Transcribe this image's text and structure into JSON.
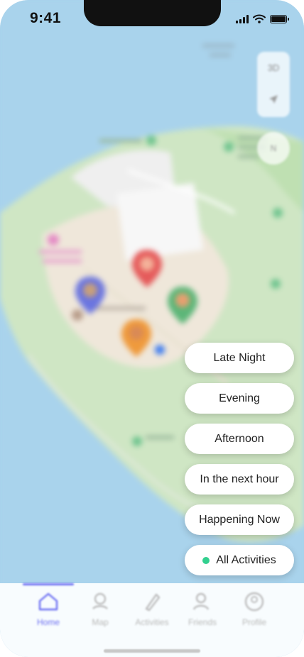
{
  "status_bar": {
    "time": "9:41"
  },
  "map": {
    "controls": {
      "view_3d_label": "3D",
      "location_icon": "location-arrow-icon",
      "compass_label": "N"
    },
    "pins": [
      {
        "name": "red-pin",
        "color": "#e55a5a",
        "icon": "food-icon"
      },
      {
        "name": "blue-pin",
        "color": "#6a75e0",
        "icon": "food-icon"
      },
      {
        "name": "green-pin",
        "color": "#5cb678",
        "icon": "food-icon"
      },
      {
        "name": "orange-pin",
        "color": "#ef9a3c",
        "icon": "food-icon"
      }
    ]
  },
  "filters": {
    "late_night": "Late Night",
    "evening": "Evening",
    "afternoon": "Afternoon",
    "next_hour": "In the next hour",
    "happening_now": "Happening Now",
    "all_activities": "All Activities",
    "active_dot_color": "#32d08f"
  },
  "tab_bar": {
    "accent": "#6c6ff2",
    "tabs": [
      {
        "label": "Home",
        "icon": "home-icon",
        "active": true
      },
      {
        "label": "Map",
        "icon": "map-icon",
        "active": false
      },
      {
        "label": "Activities",
        "icon": "activities-icon",
        "active": false
      },
      {
        "label": "Friends",
        "icon": "friends-icon",
        "active": false
      },
      {
        "label": "Profile",
        "icon": "profile-icon",
        "active": false
      }
    ]
  }
}
